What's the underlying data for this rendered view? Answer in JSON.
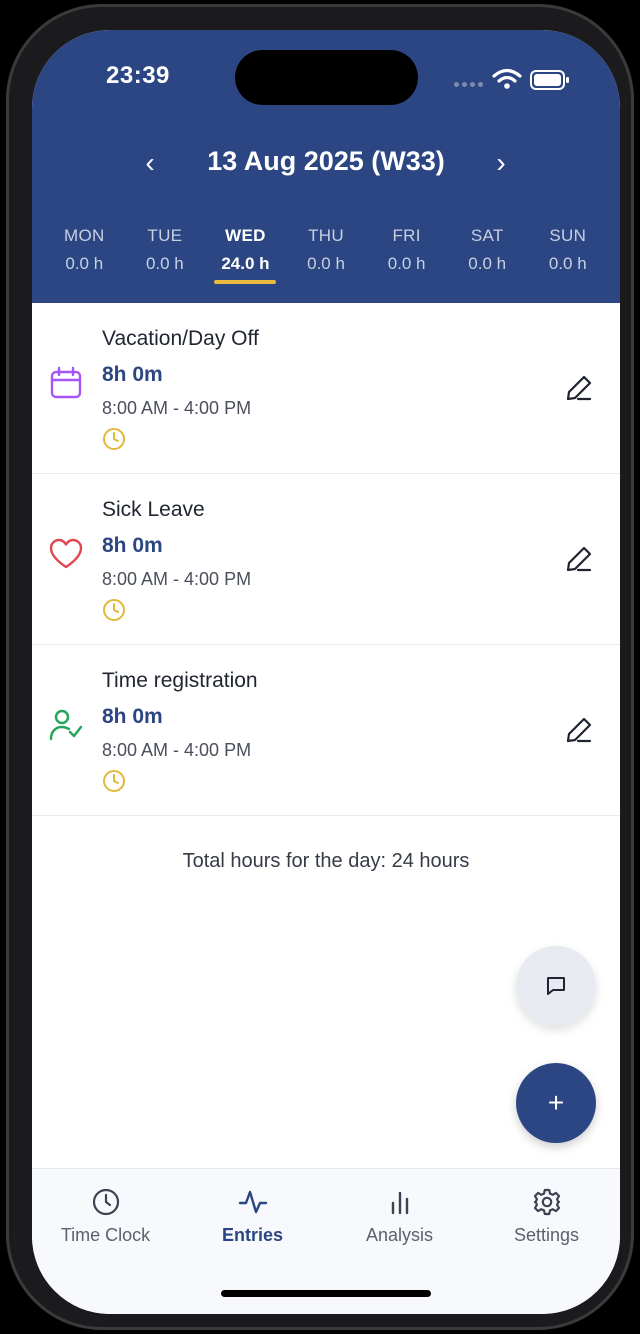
{
  "status_bar": {
    "time": "23:39"
  },
  "header": {
    "date_title": "13 Aug 2025 (W33)",
    "prev_arrow": "‹",
    "next_arrow": "›",
    "days": [
      {
        "name": "MON",
        "hours": "0.0 h",
        "active": false
      },
      {
        "name": "TUE",
        "hours": "0.0 h",
        "active": false
      },
      {
        "name": "WED",
        "hours": "24.0 h",
        "active": true
      },
      {
        "name": "THU",
        "hours": "0.0 h",
        "active": false
      },
      {
        "name": "FRI",
        "hours": "0.0 h",
        "active": false
      },
      {
        "name": "SAT",
        "hours": "0.0 h",
        "active": false
      },
      {
        "name": "SUN",
        "hours": "0.0 h",
        "active": false
      }
    ]
  },
  "entries": [
    {
      "title": "Vacation/Day Off",
      "duration": "8h 0m",
      "time_range": "8:00 AM - 4:00 PM",
      "icon": "calendar-icon",
      "icon_color": "#a855f7"
    },
    {
      "title": "Sick Leave",
      "duration": "8h 0m",
      "time_range": "8:00 AM - 4:00 PM",
      "icon": "heart-icon",
      "icon_color": "#e0484f"
    },
    {
      "title": "Time registration",
      "duration": "8h 0m",
      "time_range": "8:00 AM - 4:00 PM",
      "icon": "user-check-icon",
      "icon_color": "#22a559"
    }
  ],
  "total_text": "Total hours for the day: 24 hours",
  "fab_add_label": "+",
  "bottom_nav": {
    "tabs": [
      {
        "label": "Time Clock",
        "icon": "clock-icon",
        "active": false
      },
      {
        "label": "Entries",
        "icon": "activity-icon",
        "active": true
      },
      {
        "label": "Analysis",
        "icon": "bar-chart-icon",
        "active": false
      },
      {
        "label": "Settings",
        "icon": "gear-icon",
        "active": false
      }
    ]
  },
  "colors": {
    "primary": "#2b4682",
    "accent": "#e9b940",
    "clock": "#e0b93b"
  }
}
